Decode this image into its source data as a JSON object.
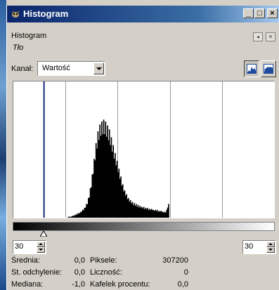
{
  "window": {
    "title": "Histogram"
  },
  "panel": {
    "title": "Histogram",
    "subtitle": "Tło"
  },
  "channel": {
    "label": "Kanał:",
    "value": "Wartość"
  },
  "range": {
    "low": "30",
    "high": "30"
  },
  "stats": {
    "mean_label": "Średnia:",
    "mean_value": "0,0",
    "stddev_label": "St. odchylenie:",
    "stddev_value": "0,0",
    "median_label": "Mediana:",
    "median_value": "-1,0",
    "pixels_label": "Piksele:",
    "pixels_value": "307200",
    "count_label": "Liczność:",
    "count_value": "0",
    "percentile_label": "Kafelek procentu:",
    "percentile_value": "0,0"
  },
  "colors": {
    "titlebar_start": "#0a246a",
    "selection_line": "#1a2a7a"
  },
  "chart_data": {
    "type": "area",
    "x_range": [
      0,
      255
    ],
    "selection_low": 30,
    "selection_high": 30,
    "values": [
      0,
      0,
      0,
      0,
      0,
      0,
      0,
      0,
      0,
      0,
      0,
      0,
      0,
      0,
      0,
      0,
      0,
      0,
      0,
      0,
      0,
      0,
      0,
      0,
      0,
      0,
      0,
      0,
      0,
      0,
      0,
      0,
      0,
      0,
      0,
      0,
      0,
      0,
      0,
      0,
      0,
      0,
      0,
      0,
      0,
      0,
      0,
      0,
      0,
      0,
      0,
      0,
      0,
      0,
      0,
      0,
      0,
      1,
      1,
      1,
      1,
      2,
      2,
      2,
      3,
      3,
      4,
      4,
      5,
      5,
      6,
      7,
      8,
      9,
      10,
      12,
      14,
      16,
      20,
      24,
      30,
      36,
      44,
      52,
      60,
      68,
      76,
      82,
      88,
      92,
      95,
      97,
      98,
      99,
      100,
      99,
      98,
      96,
      94,
      92,
      90,
      86,
      82,
      78,
      74,
      70,
      66,
      62,
      58,
      54,
      50,
      46,
      42,
      38,
      34,
      31,
      28,
      26,
      24,
      22,
      20,
      19,
      18,
      17,
      16,
      15,
      15,
      14,
      14,
      13,
      13,
      12,
      12,
      12,
      11,
      11,
      11,
      10,
      10,
      10,
      10,
      9,
      9,
      9,
      9,
      9,
      8,
      8,
      8,
      8,
      8,
      7,
      7,
      7,
      7,
      7,
      6,
      6,
      6,
      6,
      8,
      12,
      14,
      0,
      0,
      0,
      0,
      0,
      0,
      0,
      0,
      0,
      0,
      0,
      0,
      0,
      0,
      0,
      0,
      0,
      0,
      0,
      0,
      0,
      0,
      0,
      0,
      0,
      0,
      0,
      0,
      0,
      0,
      0,
      0,
      0,
      0,
      0,
      0,
      0,
      0,
      0,
      0,
      0,
      0,
      0,
      0,
      0,
      0,
      0,
      0,
      0,
      0,
      0,
      0,
      0,
      0,
      0,
      0,
      0,
      0,
      0,
      0,
      0,
      0,
      0,
      0,
      0,
      0,
      0,
      0,
      0,
      0,
      0,
      0,
      0,
      0,
      0,
      0,
      0,
      0,
      0,
      0,
      0,
      0,
      0,
      0,
      0,
      0,
      0,
      0,
      0,
      0,
      0,
      0,
      0,
      0,
      0,
      0,
      0,
      0,
      0,
      0,
      0,
      0,
      0,
      0,
      0,
      0,
      0,
      0,
      0,
      0
    ]
  }
}
